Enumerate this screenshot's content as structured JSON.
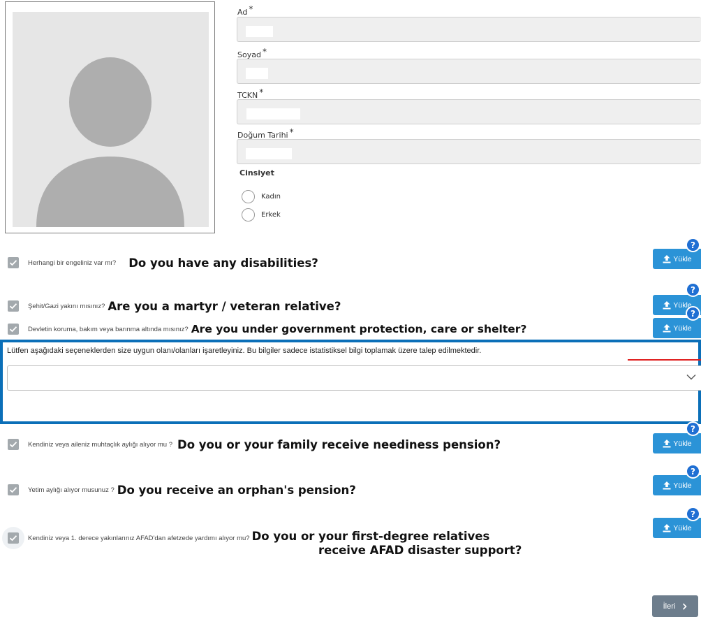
{
  "form": {
    "name_label": "Ad",
    "surname_label": "Soyad",
    "tckn_label": "TCKN",
    "birthdate_label": "Doğum Tarihi",
    "required_mark": "*"
  },
  "gender": {
    "title": "Cinsiyet",
    "options": [
      "Kadın",
      "Erkek"
    ]
  },
  "questions": [
    {
      "label": "Herhangi bir engeliniz var mı?",
      "translation": "Do you have any disabilities?",
      "checked": true
    },
    {
      "label": "Şehit/Gazi yakını mısınız?",
      "translation": "Are you a martyr / veteran relative?",
      "checked": true
    },
    {
      "label": "Devletin koruma, bakım veya barınma altında mısınız?",
      "translation": "Are you under government protection, care or shelter?",
      "checked": true
    },
    {
      "label": "Kendiniz veya aileniz muhtaçlık aylığı alıyor mu ?",
      "translation": "Do you or your family receive neediness pension?",
      "checked": true
    },
    {
      "label": "Yetim aylığı alıyor musunuz ?",
      "translation": "Do you receive an orphan's pension?",
      "checked": true
    },
    {
      "label": "Kendiniz veya 1. derece yakınlarınız AFAD'dan afetzede yardımı alıyor mu?",
      "translation_line1": "Do you or your first-degree relatives",
      "translation_line2": "receive AFAD disaster support?",
      "checked": true
    }
  ],
  "upload": {
    "label": "Yükle",
    "help": "?"
  },
  "statistics": {
    "prompt": "Lütfen aşağıdaki seçeneklerden size uygun olanı/olanları işaretleyiniz. Bu bilgiler sadece istatistiksel bilgi toplamak üzere talep edilmektedir.",
    "selected": ""
  },
  "nav": {
    "next_label": "İleri"
  },
  "colors": {
    "upload_button": "#2b93d7",
    "help_badge": "#1f6fd3",
    "highlight_border": "#0b6fb8",
    "annotation_line": "#e02020",
    "next_button": "#6d7d8c"
  }
}
